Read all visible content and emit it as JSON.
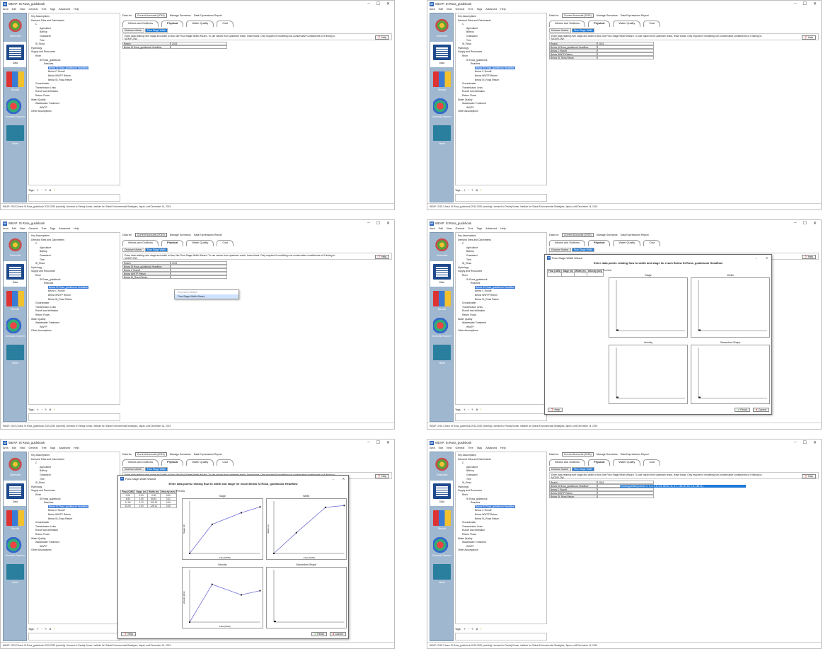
{
  "app": {
    "title": "WEAP: St Rosa_guidebook",
    "menu": [
      "Area",
      "Edit",
      "View",
      "General",
      "Tree",
      "Tags",
      "Advanced",
      "Help"
    ],
    "window_controls": [
      "–",
      "☐",
      "✕"
    ],
    "sidebar": [
      {
        "key": "schematic",
        "label": "Schematic"
      },
      {
        "key": "data",
        "label": "Data"
      },
      {
        "key": "results",
        "label": "Results"
      },
      {
        "key": "explorer",
        "label": "Scenario Explorer"
      },
      {
        "key": "notes",
        "label": "Notes"
      }
    ],
    "tree": [
      {
        "label": "Key Assumptions",
        "indent": 0
      },
      {
        "label": "Demand Sites and Catchments",
        "indent": 0
      },
      {
        "label": "C",
        "indent": 1
      },
      {
        "label": "Agriculture",
        "indent": 2
      },
      {
        "label": "Bathup",
        "indent": 2
      },
      {
        "label": "Grassland",
        "indent": 2
      },
      {
        "label": "Tree",
        "indent": 2
      },
      {
        "label": "St_Rosa",
        "indent": 1
      },
      {
        "label": "Hydrology",
        "indent": 0
      },
      {
        "label": "Supply and Resources",
        "indent": 0
      },
      {
        "label": "River",
        "indent": 1
      },
      {
        "label": "St Rosa_guidebook",
        "indent": 2
      },
      {
        "label": "Reaches",
        "indent": 3
      },
      {
        "label": "Below St Rosa_guidebook Headflow",
        "indent": 4
      },
      {
        "label": "Below C Runoff",
        "indent": 4
      },
      {
        "label": "Below WWTP Return",
        "indent": 4
      },
      {
        "label": "Below St_Rosa Return",
        "indent": 4
      },
      {
        "label": "Groundwater",
        "indent": 1
      },
      {
        "label": "Transmission Links",
        "indent": 1
      },
      {
        "label": "Runoff and Infiltration",
        "indent": 1
      },
      {
        "label": "Return Flows",
        "indent": 1
      },
      {
        "label": "Water Quality",
        "indent": 0
      },
      {
        "label": "Wastewater Treatment",
        "indent": 1
      },
      {
        "label": "WWTP",
        "indent": 2
      },
      {
        "label": "Other Assumptions",
        "indent": 0
      }
    ],
    "tags_label": "Tags:",
    "data_for_label": "Data for:",
    "data_for_value": "Current Accounts (2015)",
    "manage_scenarios": "Manage Scenarios",
    "data_expressions_report": "Data Expressions Report",
    "tabs": [
      "Inflows and Outflows",
      "Physical",
      "Water Quality",
      "Cost"
    ],
    "subtabs": [
      "Distance Marker",
      "Flow Stage Width"
    ],
    "info_text": "Enter data relating river stage and width to flow, like Flow Stage Width Wizard. To use values from upstream reach, leave blank. Only required if modelling non-conservative constituents or if linking to MODFLOW.",
    "help_label": "Help",
    "grid_header": [
      "Reach",
      "2015"
    ],
    "grid_rows": [
      "Below St Rosa_guidebook Headflow",
      "Below C Runoff",
      "Below WWTP Return",
      "Below St_Rosa Return"
    ],
    "status": "WEAP: 2019.2   Area: St Rosa_guidebook   2015-2030 (monthly)   Licensed to Pankaj Kumar, Institute for Global Environmental Strategies, Japan, until December 14, 2019"
  },
  "panels": {
    "p3": {
      "ctx_menu": [
        "Expression Builder",
        "Flow-Stage-Width Wizard"
      ]
    },
    "wizard": {
      "title": "Flow-Stage-Width Wizard",
      "header": "Enter data points relating flow to width and stage for reach Below St Rosa_guidebook Headflow",
      "preview": "Preview",
      "col_headers": [
        "Flow (CMS)",
        "Stage (m)",
        "Width (m)",
        "Velocity (m/s)"
      ],
      "charts": [
        "Stage",
        "Width",
        "Velocity",
        "Streambed Shape"
      ],
      "finish": "Finish",
      "cancel": "Cancel",
      "help": "Help"
    },
    "p5": {
      "rows": [
        [
          "0.00",
          "0.00",
          "0.00",
          "0.00"
        ],
        [
          "4.80",
          "1.50",
          "55.52",
          "0.32"
        ],
        [
          "11.00",
          "0.70",
          "123.19",
          "0.26"
        ],
        [
          "15.00",
          "1.00",
          "128.11",
          "0.28"
        ]
      ]
    },
    "p6": {
      "expression": "FlowStageWidth(Cancel, 0, 0, 0, 4.8, 0.5, 55.52, 11, 0.7, 123.19, 15, 0.8, 128.11)"
    }
  },
  "chart_data": [
    {
      "type": "line",
      "title": "Stage",
      "xlabel": "Flow [CMS]",
      "ylabel": "Stage [m]",
      "x": [
        0,
        4.8,
        11,
        15
      ],
      "y": [
        0,
        0.5,
        0.7,
        0.8
      ],
      "xlim": [
        0,
        15
      ],
      "ylim": [
        0,
        0.9
      ]
    },
    {
      "type": "line",
      "title": "Width",
      "xlabel": "Flow [CMS]",
      "ylabel": "Width [m]",
      "x": [
        0,
        4.8,
        11,
        15
      ],
      "y": [
        0,
        55.52,
        123.19,
        128.11
      ],
      "xlim": [
        0,
        15
      ],
      "ylim": [
        0,
        140
      ]
    },
    {
      "type": "line",
      "title": "Velocity",
      "xlabel": "Flow [CMS]",
      "ylabel": "Velocity [m/s]",
      "x": [
        0,
        4.8,
        11,
        15
      ],
      "y": [
        0,
        0.18,
        0.13,
        0.15
      ],
      "xlim": [
        0,
        15
      ],
      "ylim": [
        0,
        0.25
      ]
    }
  ]
}
